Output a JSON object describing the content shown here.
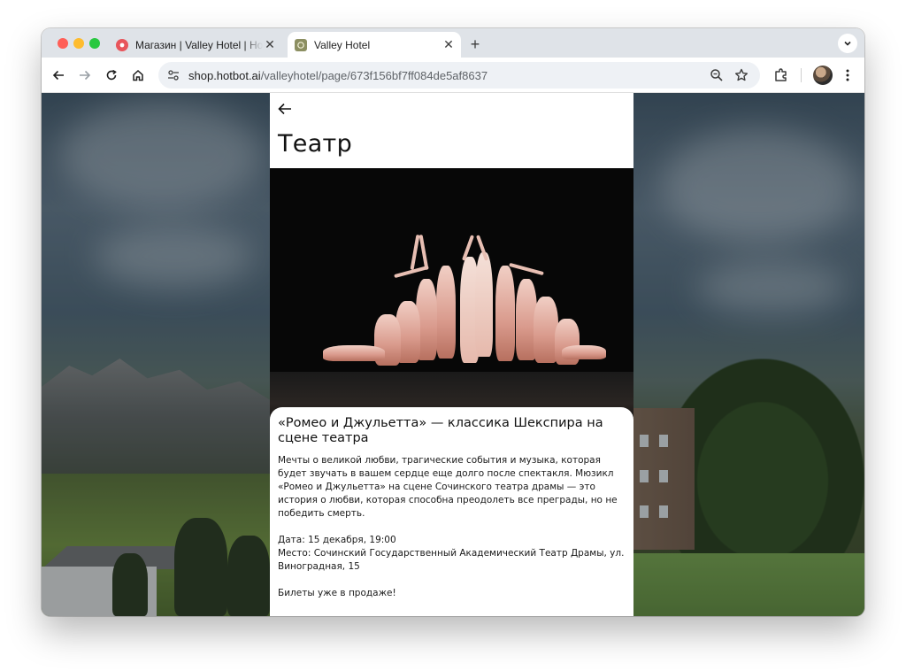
{
  "browser": {
    "tabs": [
      {
        "title": "Магазин | Valley Hotel | Hotbot",
        "active": false,
        "favicon": "hotbot-logo-icon"
      },
      {
        "title": "Valley Hotel",
        "active": true,
        "favicon": "valley-hotel-logo-icon"
      }
    ],
    "new_tab_label": "+",
    "tab_close_label": "✕",
    "url": {
      "host": "shop.hotbot.ai",
      "path": "/valleyhotel/page/673f156bf7ff084de5af8637"
    },
    "colors": {
      "tabstrip": "#dfe3e8",
      "omnibox": "#eef1f5"
    }
  },
  "page": {
    "title": "Театр",
    "article": {
      "heading": "«Ромео и Джульетта» — классика Шекспира на сцене театра",
      "description": "Мечты о великой любви, трагические события и музыка, которая будет звучать в вашем сердце еще долго после спектакля. Мюзикл «Ромео и Джульетта» на сцене Сочинского театра драмы — это история о любви, которая способна преодолеть все преграды, но не победить смерть.",
      "date_line": "Дата: 15 декабря, 19:00",
      "place_line": "Место: Сочинский Государственный Академический Театр Драмы, ул. Виноградная, 15",
      "tickets_line": "Билеты уже в продаже!"
    },
    "hero_image": "theatre-dancers-photo"
  }
}
